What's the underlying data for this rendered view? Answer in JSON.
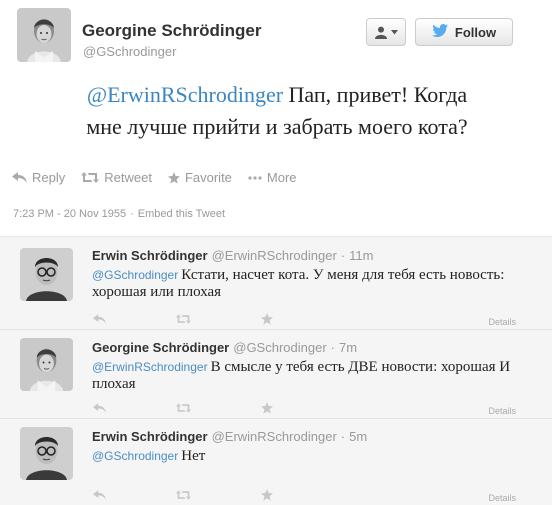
{
  "main_tweet": {
    "author_name": "Georgine Schrödinger",
    "author_handle": "@GSchrodinger",
    "follow_label": "Follow",
    "mention": "@ErwinRSchrodinger",
    "text_line1": "Пап, привет! Когда",
    "text_line2": "мне лучше прийти и забрать моего кота?",
    "actions": {
      "reply": "Reply",
      "retweet": "Retweet",
      "favorite": "Favorite",
      "more": "More"
    },
    "timestamp": "7:23 PM - 20 Nov 1955",
    "embed": "Embed this Tweet"
  },
  "replies": [
    {
      "author_name": "Erwin Schrödinger",
      "author_handle": "@ErwinRSchrodinger",
      "time": "11m",
      "mention": "@GSchrodinger",
      "text": "Кстати, насчет кота. У меня для тебя есть новость: хорошая или плохая",
      "details": "Details"
    },
    {
      "author_name": "Georgine Schrödinger",
      "author_handle": "@GSchrodinger",
      "time": "7m",
      "mention": "@ErwinRSchrodinger",
      "text": "В смысле у тебя есть ДВЕ новости: хорошая И плохая",
      "details": "Details"
    },
    {
      "author_name": "Erwin Schrödinger",
      "author_handle": "@ErwinRSchrodinger",
      "time": "5m",
      "mention": "@GSchrodinger",
      "text": "Нет",
      "details": "Details"
    }
  ],
  "colors": {
    "link": "#3b86c0",
    "twitter_bird": "#55acee",
    "muted": "#999999",
    "reply_background": "#f5f5f5"
  }
}
